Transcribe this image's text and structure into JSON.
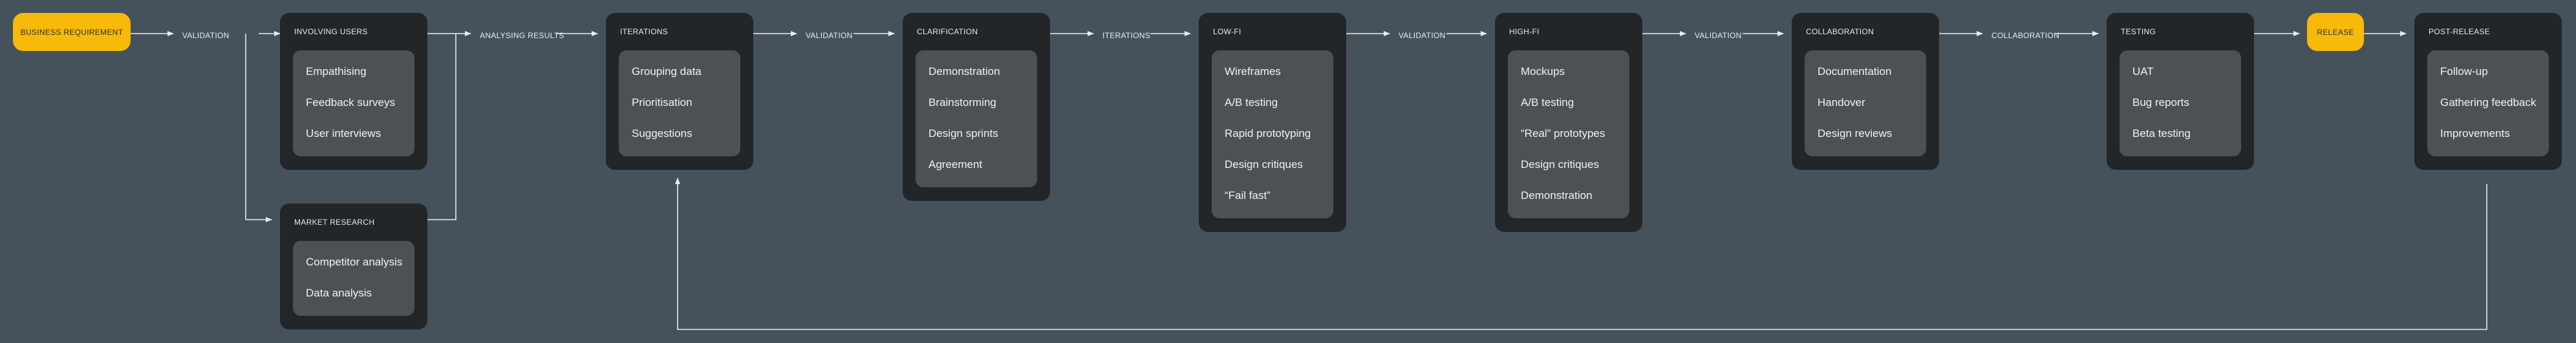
{
  "colors": {
    "background": "#46525b",
    "card": "#222629",
    "card_inner": "#4b5155",
    "accent": "#f7b90a",
    "text": "#f1f3f4",
    "line": "#e9ecee"
  },
  "start_pill": "BUSINESS REQUIREMENT",
  "release_pill": "RELEASE",
  "edge_labels": [
    "VALIDATION",
    "ANALYSING RESULTS",
    "VALIDATION",
    "ITERATIONS",
    "VALIDATION",
    "VALIDATION",
    "COLLABORATION"
  ],
  "cards": [
    {
      "id": "involving-users",
      "title": "INVOLVING USERS",
      "items": [
        "Empathising",
        "Feedback surveys",
        "User interviews"
      ]
    },
    {
      "id": "market-research",
      "title": "MARKET RESEARCH",
      "items": [
        "Competitor analysis",
        "Data analysis"
      ]
    },
    {
      "id": "iterations",
      "title": "ITERATIONS",
      "items": [
        "Grouping data",
        "Prioritisation",
        "Suggestions"
      ]
    },
    {
      "id": "clarification",
      "title": "CLARIFICATION",
      "items": [
        "Demonstration",
        "Brainstorming",
        "Design sprints",
        "Agreement"
      ]
    },
    {
      "id": "low-fi",
      "title": "LOW-FI",
      "items": [
        "Wireframes",
        "A/B testing",
        "Rapid prototyping",
        "Design critiques",
        "“Fail fast”"
      ]
    },
    {
      "id": "high-fi",
      "title": "HIGH-FI",
      "items": [
        "Mockups",
        "A/B testing",
        "“Real” prototypes",
        "Design critiques",
        "Demonstration"
      ]
    },
    {
      "id": "collaboration",
      "title": "COLLABORATION",
      "items": [
        "Documentation",
        "Handover",
        "Design reviews"
      ]
    },
    {
      "id": "testing",
      "title": "TESTING",
      "items": [
        "UAT",
        "Bug reports",
        "Beta testing"
      ]
    },
    {
      "id": "post-release",
      "title": "POST-RELEASE",
      "items": [
        "Follow-up",
        "Gathering feedback",
        "Improvements"
      ]
    }
  ]
}
